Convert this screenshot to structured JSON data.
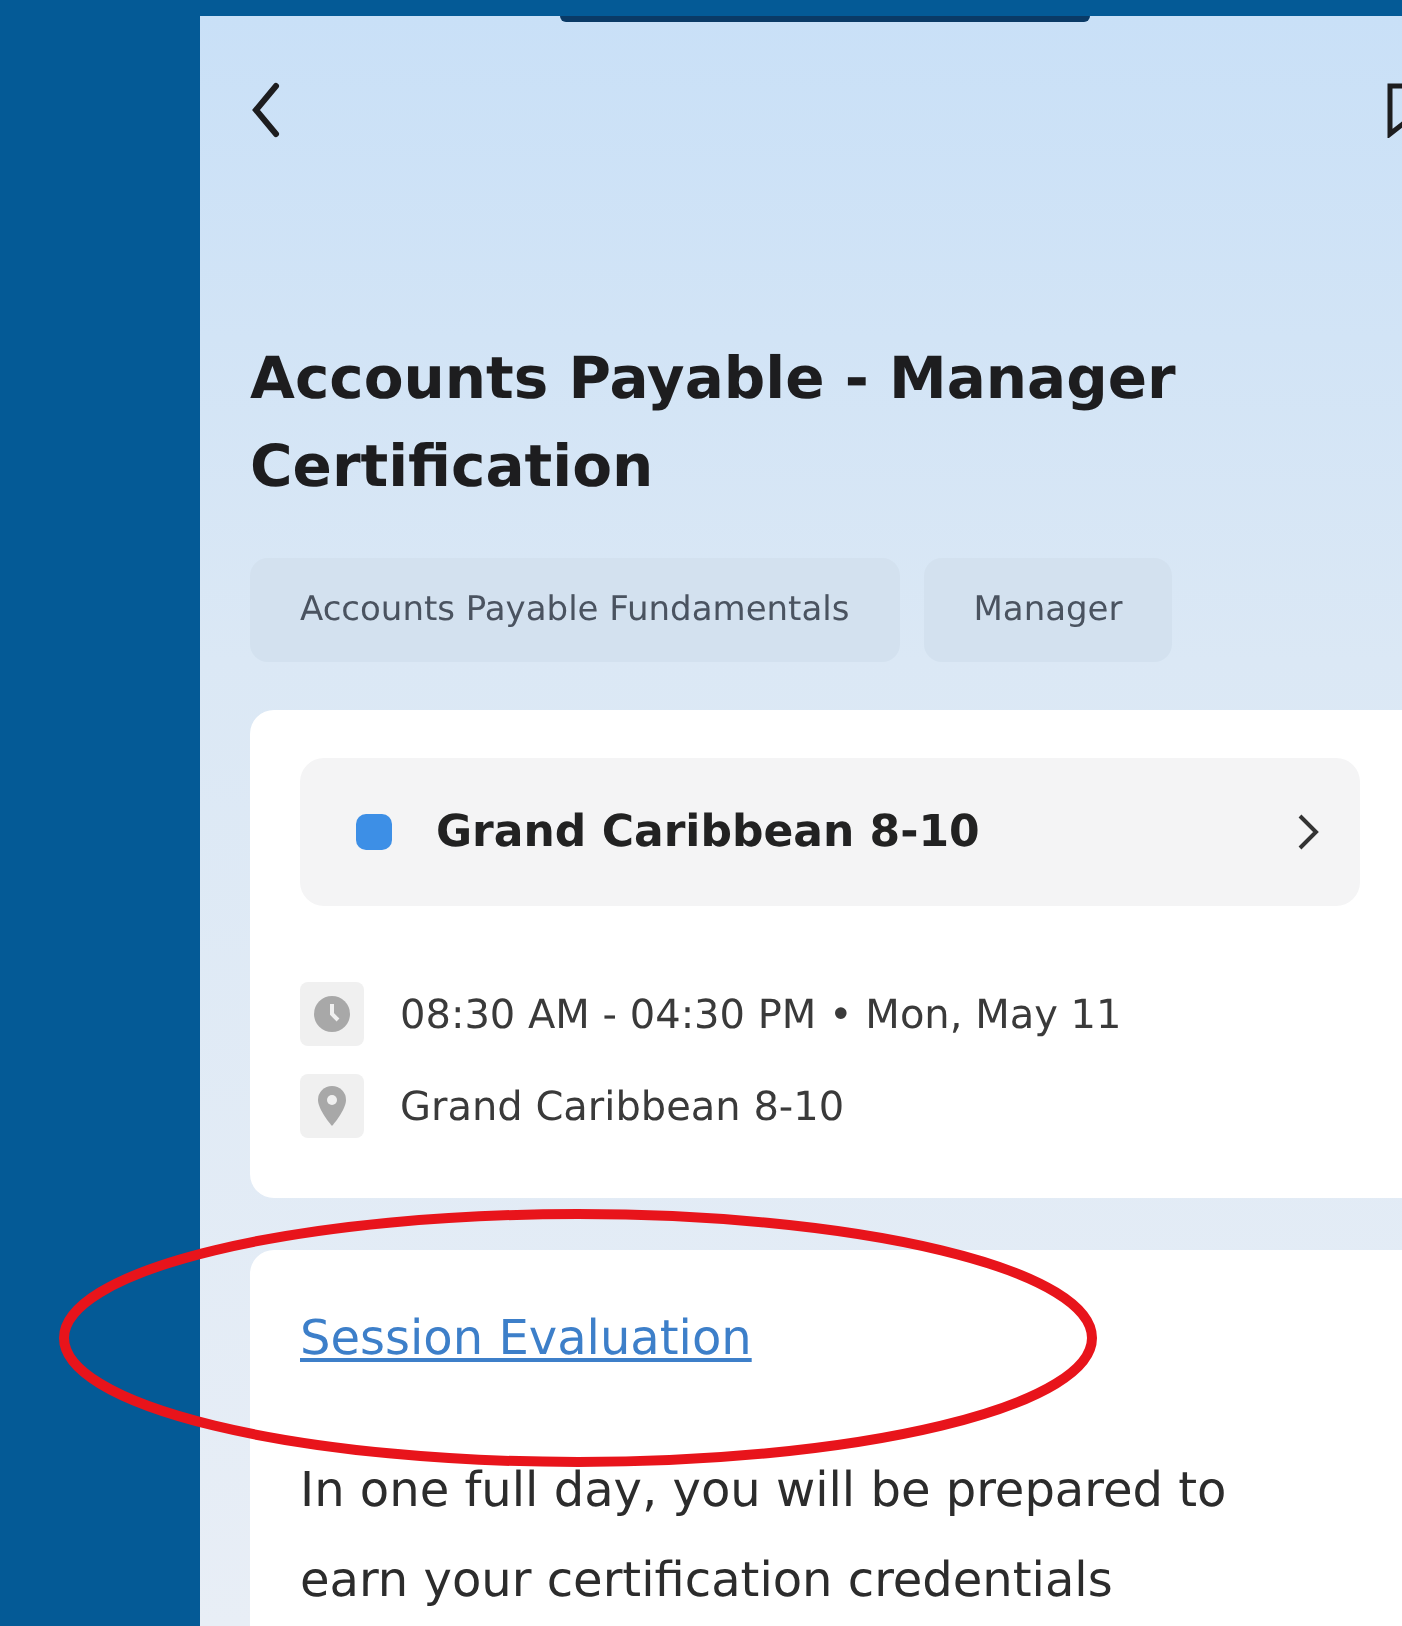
{
  "header": {
    "title": "Accounts Payable - Manager Certification"
  },
  "tags": [
    "Accounts Payable Fundamentals",
    "Manager"
  ],
  "session": {
    "room": "Grand Caribbean 8-10",
    "color": "#3d8fe6",
    "details": [
      {
        "kind": "time",
        "text": "08:30 AM - 04:30 PM • Mon, May 11"
      },
      {
        "kind": "location",
        "text": "Grand Caribbean 8-10"
      }
    ]
  },
  "description": {
    "link": "Session Evaluation",
    "text": "In one full day, you will be prepared to earn your certification credentials"
  },
  "annotation": {
    "kind": "ellipse",
    "color": "#e8141b"
  }
}
